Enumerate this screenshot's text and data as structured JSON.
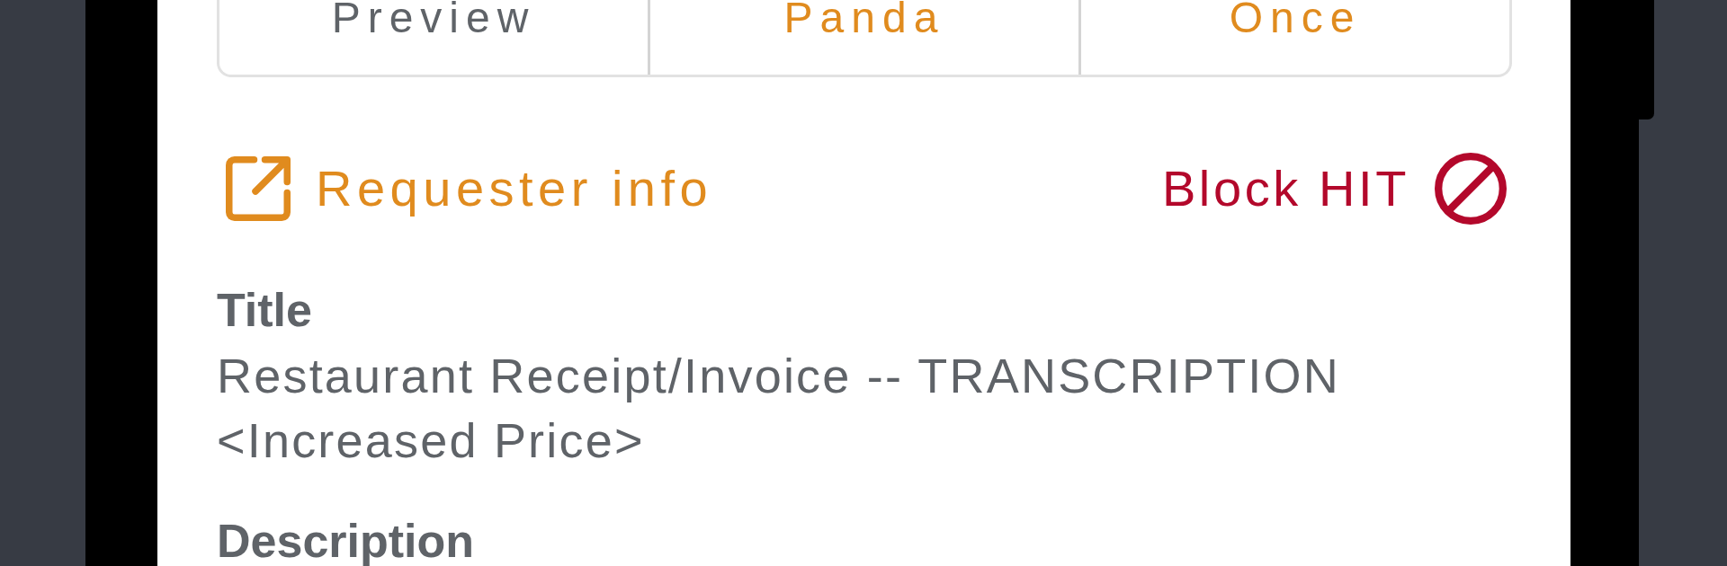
{
  "tabs": [
    {
      "label": "Preview",
      "kind": "plain"
    },
    {
      "label": "Panda",
      "kind": "accent"
    },
    {
      "label": "Once",
      "kind": "accent"
    }
  ],
  "actions": [
    {
      "label": "Requester info",
      "kind": "external"
    },
    {
      "label": "Block HIT",
      "kind": "block"
    }
  ],
  "fields": [
    {
      "label": "Title",
      "value": "Restaurant Receipt/Invoice -- TRANSCRIPTION <Increased Price>"
    },
    {
      "label": "Description"
    }
  ]
}
